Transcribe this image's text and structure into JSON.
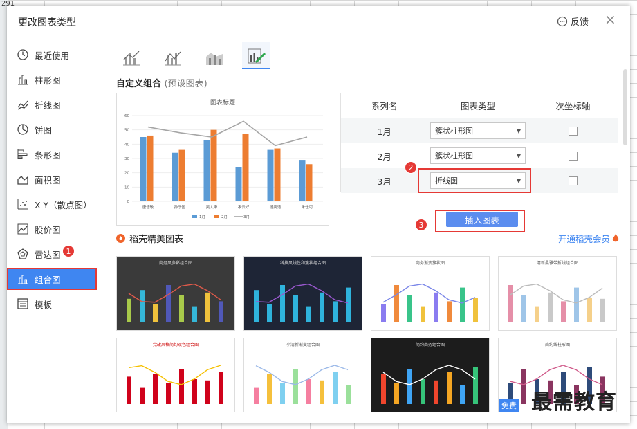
{
  "corner_text": "291",
  "dialog": {
    "title": "更改图表类型",
    "feedback": "反馈",
    "close": "×"
  },
  "sidebar": {
    "items": [
      {
        "label": "最近使用",
        "icon": "clock-icon"
      },
      {
        "label": "柱形图",
        "icon": "column-chart-icon"
      },
      {
        "label": "折线图",
        "icon": "line-chart-icon"
      },
      {
        "label": "饼图",
        "icon": "pie-chart-icon"
      },
      {
        "label": "条形图",
        "icon": "bar-chart-icon"
      },
      {
        "label": "面积图",
        "icon": "area-chart-icon"
      },
      {
        "label": "X Y（散点图）",
        "icon": "scatter-chart-icon"
      },
      {
        "label": "股价图",
        "icon": "stock-chart-icon"
      },
      {
        "label": "雷达图",
        "icon": "radar-chart-icon"
      },
      {
        "label": "组合图",
        "icon": "combo-chart-icon"
      },
      {
        "label": "模板",
        "icon": "template-icon"
      }
    ],
    "active_index": 9
  },
  "badges": [
    "1",
    "2",
    "3"
  ],
  "section": {
    "title": "自定义组合",
    "subtitle": "(预设图表)"
  },
  "preview": {
    "chart_data": {
      "type": "bar",
      "title": "图表标题",
      "categories": [
        "唐悟敬",
        "孙予国",
        "吴大帝",
        "孝云好",
        "德腐涪",
        "朱仕可"
      ],
      "ylim": [
        0,
        60
      ],
      "yticks": [
        "0",
        "10",
        "20",
        "30",
        "40",
        "50",
        "60"
      ],
      "series": [
        {
          "name": "1月",
          "type": "bar",
          "color": "#5b9bd5",
          "values": [
            45,
            34,
            43,
            24,
            36,
            29
          ]
        },
        {
          "name": "2月",
          "type": "bar",
          "color": "#ed7d31",
          "values": [
            46,
            36,
            50,
            47,
            37,
            26
          ]
        },
        {
          "name": "3月",
          "type": "line",
          "color": "#a5a5a5",
          "values": [
            52,
            48,
            45,
            56,
            39,
            45
          ]
        }
      ]
    }
  },
  "series_table": {
    "headers": [
      "系列名",
      "图表类型",
      "次坐标轴"
    ],
    "rows": [
      {
        "name": "1月",
        "type": "簇状柱形图"
      },
      {
        "name": "2月",
        "type": "簇状柱形图"
      },
      {
        "name": "3月",
        "type": "折线图"
      }
    ]
  },
  "insert_button": "插入图表",
  "premium": {
    "title": "稻壳精美图表",
    "vip_link": "开通稻壳会员"
  },
  "thumbnails": [
    {
      "title": "商务风多彩组合图"
    },
    {
      "title": "科技风线性和簇状组合图"
    },
    {
      "title": "商务渐变簇状图"
    },
    {
      "title": "清新柔雅带折线组合图"
    },
    {
      "title": "党政风格简约双色组合图"
    },
    {
      "title": "小清新渐变组合图"
    },
    {
      "title": "简约商务组合图"
    },
    {
      "title": "简约线柱形图",
      "free": "免费"
    }
  ],
  "watermark": "最需教育",
  "colors": {
    "accent": "#3f86f1",
    "highlight": "#e53935"
  }
}
